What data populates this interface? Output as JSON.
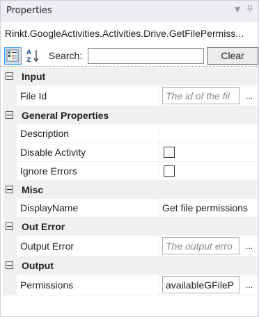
{
  "panel": {
    "title": "Properties",
    "controls": {
      "dropdown_icon": "▼",
      "pin_icon": "ꟷ"
    }
  },
  "type_name": "Rinkt.GoogleActivities.Activities.Drive.GetFilePermiss...",
  "toolbar": {
    "search_label": "Search:",
    "search_value": "",
    "clear_label": "Clear",
    "categorized_icon": "categorized-view-icon",
    "alphabetical_icon": "alphabetical-sort-icon"
  },
  "categories": [
    {
      "name": "Input",
      "rows": [
        {
          "label": "File Id",
          "value": "The id of the fil",
          "kind": "placeholder-ellipsis"
        }
      ]
    },
    {
      "name": "General Properties",
      "rows": [
        {
          "label": "Description",
          "value": "",
          "kind": "text"
        },
        {
          "label": "Disable Activity",
          "value": "",
          "kind": "checkbox"
        },
        {
          "label": "Ignore Errors",
          "value": "",
          "kind": "checkbox"
        }
      ]
    },
    {
      "name": "Misc",
      "rows": [
        {
          "label": "DisplayName",
          "value": "Get file permissions",
          "kind": "text"
        }
      ]
    },
    {
      "name": "Out Error",
      "rows": [
        {
          "label": "Output Error",
          "value": "The output erro",
          "kind": "placeholder-ellipsis"
        }
      ]
    },
    {
      "name": "Output",
      "rows": [
        {
          "label": "Permissions",
          "value": "availableGFileP",
          "kind": "value-ellipsis"
        }
      ]
    }
  ],
  "ellipsis_label": "..."
}
